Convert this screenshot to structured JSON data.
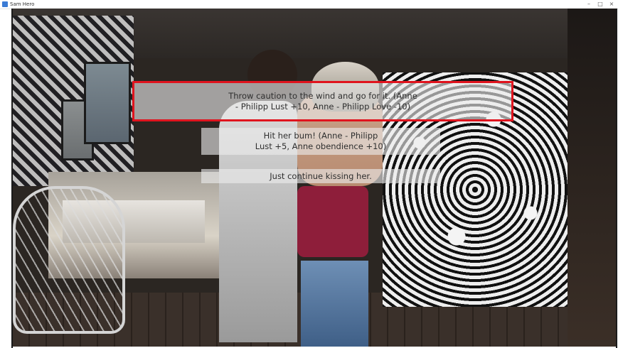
{
  "window": {
    "title": "Sam Hero",
    "controls": [
      "–",
      "□",
      "×"
    ]
  },
  "choices": [
    {
      "label": "Throw caution to the wind and go for it. (Anne\n- Philipp Lust +10, Anne - Philipp Love -10)",
      "highlighted": true
    },
    {
      "label": "Hit her bum! (Anne - Philipp\nLust +5, Anne obendience +10)",
      "highlighted": false
    },
    {
      "label": "Just continue kissing her.",
      "highlighted": false
    }
  ],
  "colors": {
    "highlight_border": "#e0141e",
    "choice_background": "rgba(235,235,235,0.62)"
  }
}
